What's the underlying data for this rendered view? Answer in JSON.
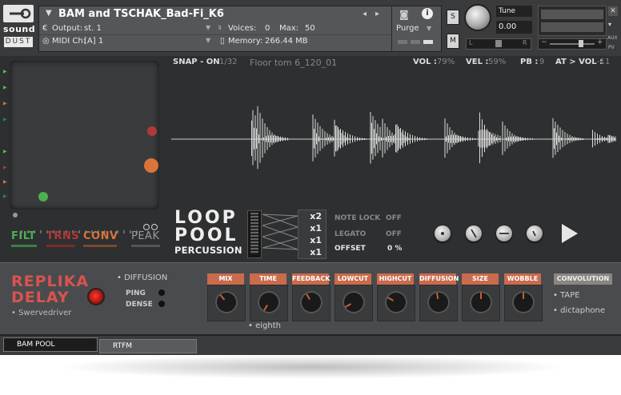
{
  "header": {
    "logo": {
      "line1": "sound",
      "line2": "DUST"
    },
    "instrument_name": "BAM and TSCHAK_Bad-Fi_K6",
    "output_label": "Output:",
    "output_value": "st. 1",
    "voices_label": "Voices:",
    "voices_value": "0",
    "max_label": "Max:",
    "max_value": "50",
    "purge_label": "Purge",
    "midi_label": "MIDI Ch:",
    "midi_value": "[A]  1",
    "memory_label": "Memory:",
    "memory_value": "266.44 MB",
    "s_button": "S",
    "m_button": "M",
    "tune_label": "Tune",
    "tune_value": "0.00",
    "pan_left": "L",
    "pan_right": "R",
    "aux_label": "AUX",
    "pv_label": "PV"
  },
  "xy_tabs": [
    {
      "label": "FILT",
      "color": "#4caf50"
    },
    {
      "label": "TRNS",
      "color": "#b03a36"
    },
    {
      "label": "CONV",
      "color": "#d9743a"
    },
    {
      "label": "PEAK",
      "color": "#9a9a9a"
    }
  ],
  "top_bar": {
    "snap": "SNAP - ON",
    "division": "1/32",
    "sample_name": "Floor tom 6_120_01",
    "vol_label": "VOL :",
    "vol_value": "79%",
    "vel_label": "VEL :",
    "vel_value": "59%",
    "pb_label": "PB :",
    "pb_value": "9",
    "at_label": "AT > VOL :",
    "at_value": "-11"
  },
  "loop_logo": {
    "line1": "LOOP",
    "line2": "POOL",
    "line3": "PERCUSSION"
  },
  "multipliers": [
    "x2",
    "x1",
    "x1",
    "x1"
  ],
  "params": [
    {
      "label": "NOTE LOCK",
      "value": "OFF",
      "active": false
    },
    {
      "label": "LEGATO",
      "value": "OFF",
      "active": false
    },
    {
      "label": "OFFSET",
      "value": "0 %",
      "active": true
    }
  ],
  "fx": {
    "title_line1": "REPLIKA",
    "title_line2": "DELAY",
    "mode_diffusion": "DIFFUSION",
    "ping": "PING",
    "dense": "DENSE",
    "preset": "Swervedriver",
    "knobs": [
      "MIX",
      "TIME",
      "FEEDBACK",
      "LOWCUT",
      "HIGHCUT",
      "DIFFUSION",
      "SIZE",
      "WOBBLE"
    ],
    "time_sync": "eighth",
    "convolution": "CONVOLUTION",
    "conv_tape": "TAPE",
    "conv_dictaphone": "dictaphone"
  },
  "bottom_tabs": [
    "BAM POOL",
    "RTFM"
  ]
}
